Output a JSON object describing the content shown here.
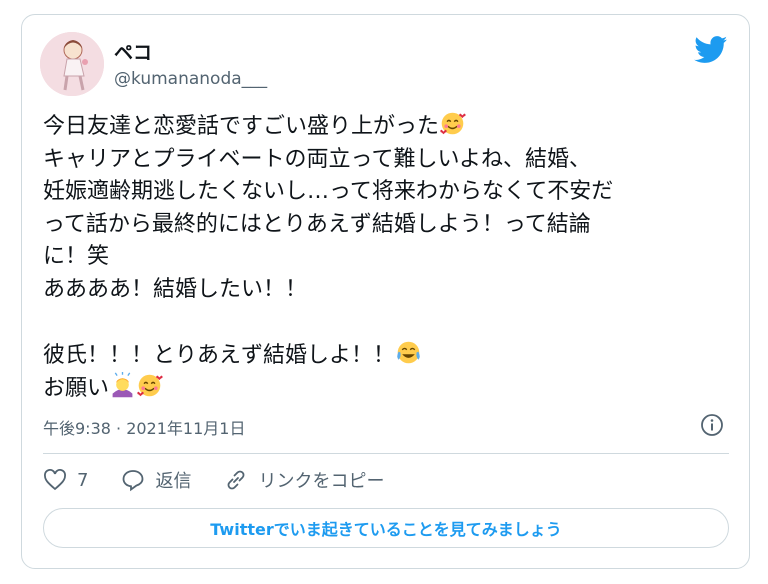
{
  "author": {
    "name": "ペコ",
    "handle": "@kumananoda___"
  },
  "tweet": {
    "lines": [
      "今日友達と恋愛話ですごい盛り上がった",
      "キャリアとプライベートの両立って難しいよね、結婚、",
      "妊娠適齢期逃したくないし…って将来わからなくて不安だ",
      "って話から最終的にはとりあえず結婚しよう！って結論",
      "に！笑",
      "ああああ！結婚したい！！",
      "",
      "彼氏！！！とりあえず結婚しよ！！",
      "お願い"
    ]
  },
  "meta": {
    "time": "午後9:38 · 2021年11月1日"
  },
  "actions": {
    "like_count": "7",
    "reply_label": "返信",
    "copy_link_label": "リンクをコピー"
  },
  "cta": {
    "label": "Twitterでいま起きていることを見てみましょう"
  },
  "colors": {
    "accent": "#1d9bf0",
    "muted": "#536471",
    "border": "#cfd9de"
  },
  "icons": [
    "twitter-bird-icon",
    "info-icon",
    "heart-icon",
    "reply-icon",
    "link-icon",
    "smiling-hearts-emoji",
    "tears-of-joy-emoji",
    "bowing-person-emoji"
  ]
}
